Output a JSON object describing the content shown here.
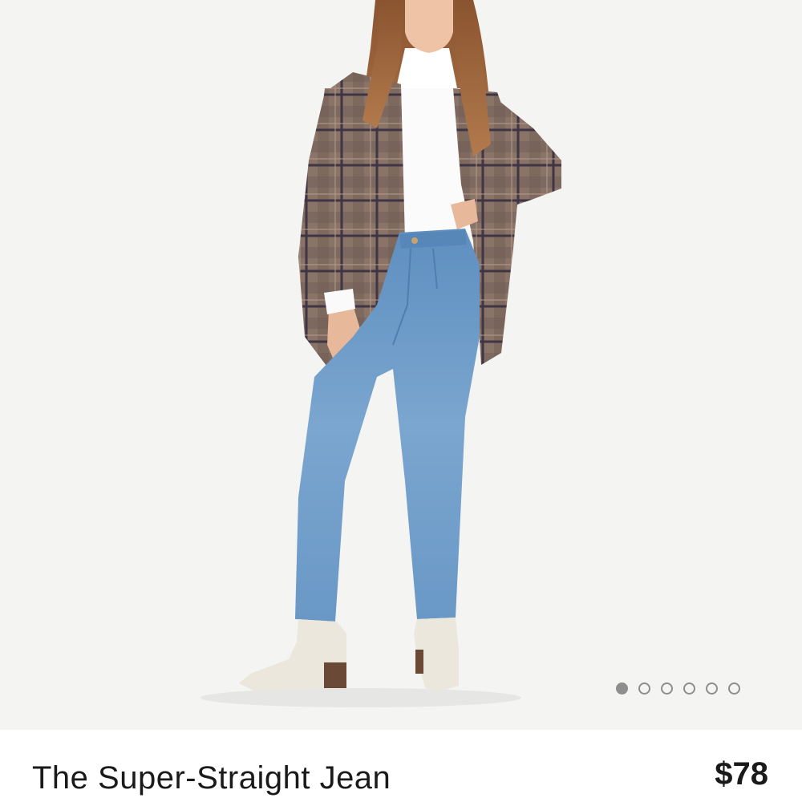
{
  "product": {
    "name": "The Super-Straight Jean",
    "price": "$78"
  },
  "gallery": {
    "image_count": 6,
    "active_index": 0,
    "image_description": "model wearing plaid blazer, white turtleneck, light-wash straight jeans and cream ankle boots"
  },
  "colors": {
    "background": "#f4f4f3",
    "dot": "#8e8e8e",
    "text": "#1a1a1a"
  }
}
